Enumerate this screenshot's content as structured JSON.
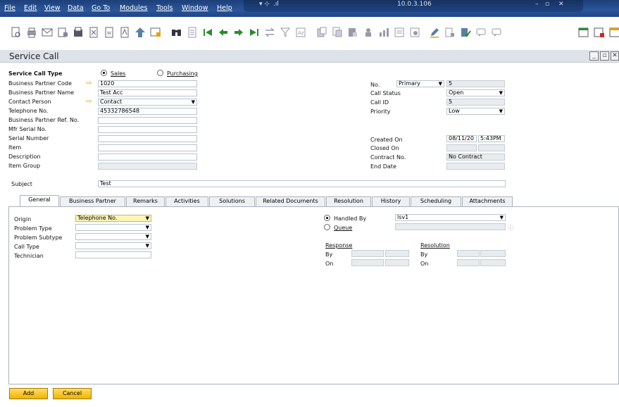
{
  "menu": {
    "items": [
      "File",
      "Edit",
      "View",
      "Data",
      "Go To",
      "Modules",
      "Tools",
      "Window",
      "Help"
    ]
  },
  "window_controls": {
    "server_text": "10.0.3.106",
    "minimize": "–",
    "restore": "▫",
    "close": "✕"
  },
  "window": {
    "title": "Service Call"
  },
  "header": {
    "service_call_type_label": "Service Call Type",
    "type_options": [
      {
        "label": "Sales",
        "selected": true
      },
      {
        "label": "Purchasing",
        "selected": false
      }
    ],
    "bp_code_label": "Business Partner Code",
    "bp_code_value": "1020",
    "bp_name_label": "Business Partner Name",
    "bp_name_value": "Test Acc",
    "contact_person_label": "Contact Person",
    "contact_person_value": "Contact",
    "telephone_label": "Telephone No.",
    "telephone_value": "45332786548",
    "bp_ref_label": "Business Partner Ref. No.",
    "mfr_serial_label": "Mfr Serial No.",
    "serial_number_label": "Serial Number",
    "item_label": "Item",
    "description_label": "Description",
    "item_group_label": "Item Group",
    "no_label": "No.",
    "no_series_value": "Primary",
    "no_value": "5",
    "call_status_label": "Call Status",
    "call_status_value": "Open",
    "call_id_label": "Call ID",
    "call_id_value": "5",
    "priority_label": "Priority",
    "priority_value": "Low",
    "created_on_label": "Created On",
    "created_on_date": "08/11/20",
    "created_on_time": "5:43PM",
    "closed_on_label": "Closed On",
    "contract_no_label": "Contract No.",
    "contract_no_value": "No Contract",
    "end_date_label": "End Date",
    "subject_label": "Subject",
    "subject_value": "Test"
  },
  "tabs": [
    {
      "label": "General",
      "active": true
    },
    {
      "label": "Business Partner",
      "active": false
    },
    {
      "label": "Remarks",
      "active": false
    },
    {
      "label": "Activities",
      "active": false
    },
    {
      "label": "Solutions",
      "active": false
    },
    {
      "label": "Related Documents",
      "active": false
    },
    {
      "label": "Resolution",
      "active": false
    },
    {
      "label": "History",
      "active": false
    },
    {
      "label": "Scheduling",
      "active": false
    },
    {
      "label": "Attachments",
      "active": false
    }
  ],
  "general": {
    "origin_label": "Origin",
    "origin_value": "Telephone No.",
    "problem_type_label": "Problem Type",
    "problem_subtype_label": "Problem Subtype",
    "call_type_label": "Call Type",
    "technician_label": "Technician",
    "handled_by_label": "Handled By",
    "handled_by_value": "lsv1",
    "queue_label": "Queue",
    "response_label": "Response",
    "resolution_label": "Resolution",
    "by_label": "By",
    "on_label": "On"
  },
  "buttons": {
    "add": "Add",
    "cancel": "Cancel"
  },
  "colors": {
    "menubar": "#2a5599",
    "button": "#f0b400",
    "required_field": "#fdf6b6",
    "link_arrow": "#e8a000"
  }
}
